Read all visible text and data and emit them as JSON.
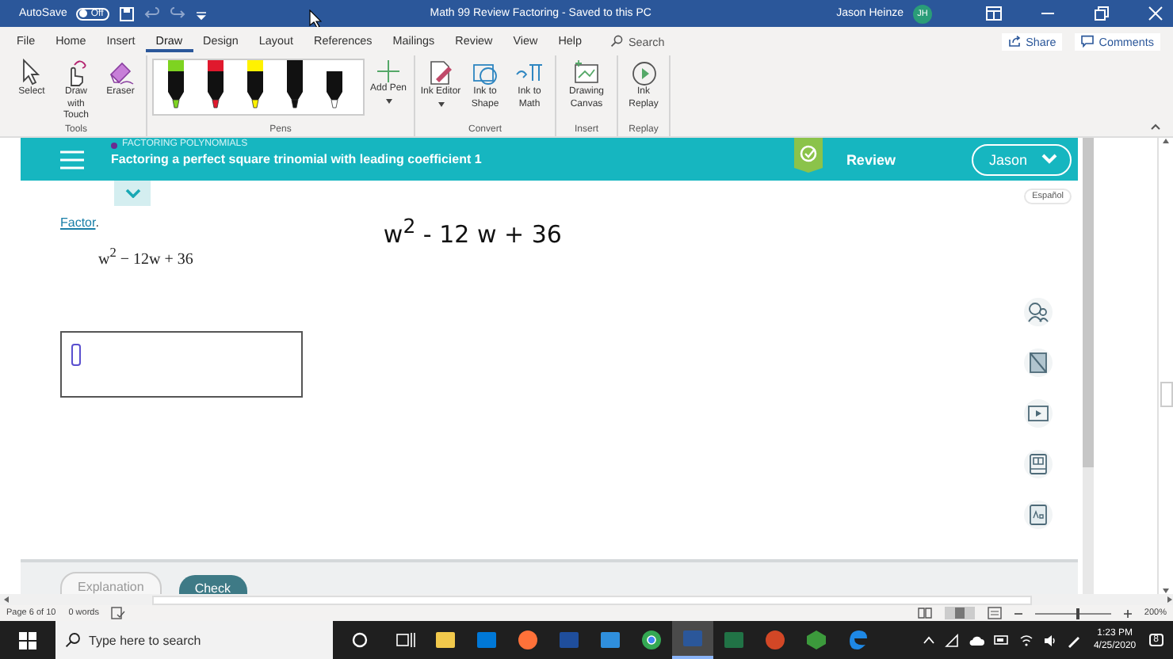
{
  "title_bar": {
    "autosave_label": "AutoSave",
    "autosave": {
      "label": "Off",
      "on": false
    },
    "title": "Math 99 Review Factoring - Saved to this PC",
    "user_name": "Jason Heinze",
    "user_initials": "JH"
  },
  "tabs": [
    {
      "label": "File",
      "selected": false
    },
    {
      "label": "Home",
      "selected": false
    },
    {
      "label": "Insert",
      "selected": false
    },
    {
      "label": "Draw",
      "selected": true
    },
    {
      "label": "Design",
      "selected": false
    },
    {
      "label": "Layout",
      "selected": false
    },
    {
      "label": "References",
      "selected": false
    },
    {
      "label": "Mailings",
      "selected": false
    },
    {
      "label": "Review",
      "selected": false
    },
    {
      "label": "View",
      "selected": false
    },
    {
      "label": "Help",
      "selected": false
    }
  ],
  "search": {
    "placeholder": "Search"
  },
  "share_button": "Share",
  "comments_button": "Comments",
  "ribbon": {
    "tools": {
      "label": "Tools",
      "buttons": [
        {
          "kind": "select",
          "label": "Select"
        },
        {
          "kind": "touch",
          "label": "Draw with Touch"
        },
        {
          "kind": "eraser",
          "label": "Eraser"
        }
      ]
    },
    "pens": {
      "label": "Pens",
      "items": [
        {
          "color": "#7ed321"
        },
        {
          "color": "#e0192d"
        },
        {
          "color": "#fff200"
        },
        {
          "color": "#111111"
        },
        {
          "color": "#ffffff"
        }
      ],
      "add_pen": "Add Pen"
    },
    "convert": {
      "label": "Convert",
      "buttons": [
        {
          "kind": "ink-editor",
          "label": "Ink Editor"
        },
        {
          "kind": "ink-shape",
          "label": "Ink to Shape"
        },
        {
          "kind": "ink-math",
          "label": "Ink to Math"
        }
      ]
    },
    "insert": {
      "label": "Insert",
      "buttons": [
        {
          "kind": "canvas",
          "label": "Drawing Canvas"
        }
      ]
    },
    "replay": {
      "label": "Replay",
      "buttons": [
        {
          "kind": "replay",
          "label": "Ink Replay"
        }
      ]
    }
  },
  "lesson": {
    "topic": "FACTORING POLYNOMIALS",
    "title": "Factoring a perfect square trinomial with leading coefficient 1",
    "review_label": "Review",
    "user_button": "Jason",
    "language_button": "Español",
    "instruction_link": "Factor",
    "instruction_end": ".",
    "expression": "w$^{2}$ − 12w + 36",
    "ink_text": "w$^{2}$ - 12 w + 36",
    "side_tools": [
      {
        "kind": "ask"
      },
      {
        "kind": "calculator"
      },
      {
        "kind": "video"
      },
      {
        "kind": "textbook"
      },
      {
        "kind": "dictionary"
      }
    ],
    "buttons": [
      {
        "kind": "secondary",
        "label": "Explanation"
      },
      {
        "kind": "primary",
        "label": "Check"
      }
    ]
  },
  "status_bar": {
    "page": "Page 6 of 10",
    "words": "0 words",
    "zoom": {
      "level": 0.55
    },
    "zoom_label": "200%"
  },
  "taskbar": {
    "search_placeholder": "Type here to search",
    "apps": [
      {
        "kind": "explorer",
        "active": false
      },
      {
        "kind": "store",
        "active": false
      },
      {
        "kind": "firefox",
        "active": false
      },
      {
        "kind": "b-app",
        "active": false
      },
      {
        "kind": "mail",
        "active": false
      },
      {
        "kind": "chrome",
        "active": false
      },
      {
        "kind": "word",
        "active": true
      },
      {
        "kind": "excel",
        "active": false
      },
      {
        "kind": "powerpoint",
        "active": false
      },
      {
        "kind": "green-app",
        "active": false
      },
      {
        "kind": "edge",
        "active": false
      }
    ],
    "time": "1:23 PM",
    "date": "4/25/2020",
    "notifications": "8"
  }
}
